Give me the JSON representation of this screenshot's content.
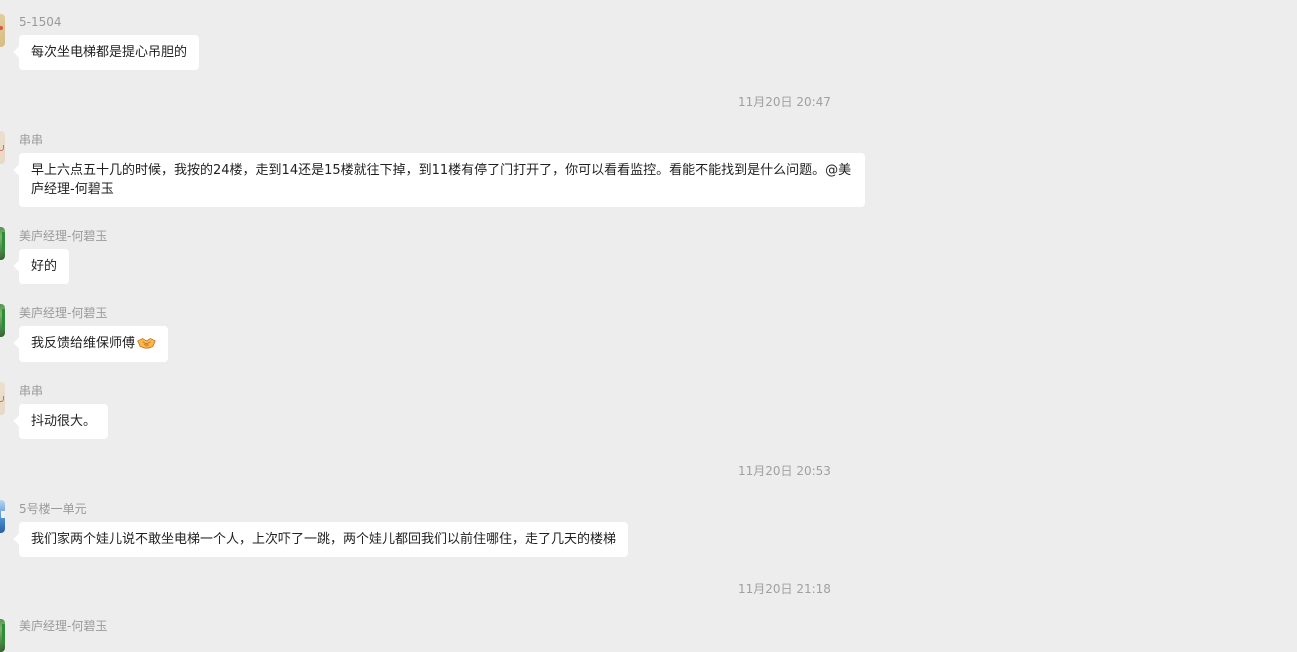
{
  "messages": [
    {
      "sender": "5-1504",
      "text": "每次坐电梯都是提心吊胆的"
    },
    {
      "time": "11月20日 20:47"
    },
    {
      "sender": "串串",
      "text": "早上六点五十几的时候，我按的24楼，走到14还是15楼就往下掉，到11楼有停了门打开了，你可以看看监控。看能不能找到是什么问题。@美庐经理-何碧玉"
    },
    {
      "sender": "美庐经理-何碧玉",
      "text": "好的"
    },
    {
      "sender": "美庐经理-何碧玉",
      "text": "我反馈给维保师傅",
      "emoji": "handshake-emoji"
    },
    {
      "sender": "串串",
      "text": "抖动很大。"
    },
    {
      "time": "11月20日 20:53"
    },
    {
      "sender": "5号楼一单元",
      "text": "我们家两个娃儿说不敢坐电梯一个人，上次吓了一跳，两个娃儿都回我们以前住哪住，走了几天的楼梯"
    },
    {
      "time": "11月20日 21:18"
    }
  ],
  "partial_sender": "美庐经理-何碧玉"
}
